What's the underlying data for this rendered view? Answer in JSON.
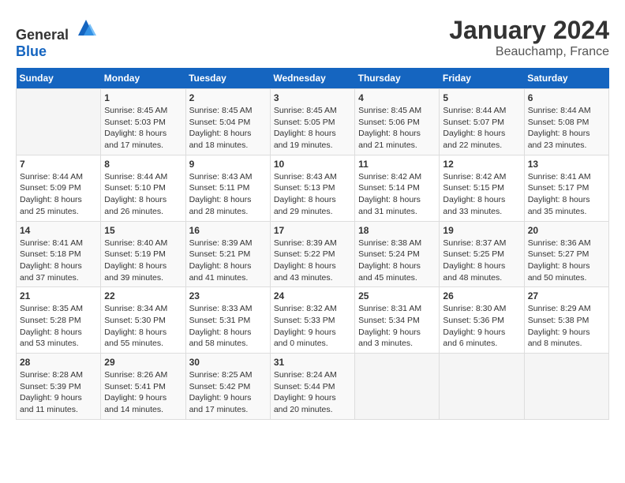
{
  "header": {
    "logo": {
      "text_general": "General",
      "text_blue": "Blue"
    },
    "title": "January 2024",
    "subtitle": "Beauchamp, France"
  },
  "calendar": {
    "days_of_week": [
      "Sunday",
      "Monday",
      "Tuesday",
      "Wednesday",
      "Thursday",
      "Friday",
      "Saturday"
    ],
    "weeks": [
      [
        {
          "day": "",
          "sunrise": "",
          "sunset": "",
          "daylight": ""
        },
        {
          "day": "1",
          "sunrise": "Sunrise: 8:45 AM",
          "sunset": "Sunset: 5:03 PM",
          "daylight": "Daylight: 8 hours and 17 minutes."
        },
        {
          "day": "2",
          "sunrise": "Sunrise: 8:45 AM",
          "sunset": "Sunset: 5:04 PM",
          "daylight": "Daylight: 8 hours and 18 minutes."
        },
        {
          "day": "3",
          "sunrise": "Sunrise: 8:45 AM",
          "sunset": "Sunset: 5:05 PM",
          "daylight": "Daylight: 8 hours and 19 minutes."
        },
        {
          "day": "4",
          "sunrise": "Sunrise: 8:45 AM",
          "sunset": "Sunset: 5:06 PM",
          "daylight": "Daylight: 8 hours and 21 minutes."
        },
        {
          "day": "5",
          "sunrise": "Sunrise: 8:44 AM",
          "sunset": "Sunset: 5:07 PM",
          "daylight": "Daylight: 8 hours and 22 minutes."
        },
        {
          "day": "6",
          "sunrise": "Sunrise: 8:44 AM",
          "sunset": "Sunset: 5:08 PM",
          "daylight": "Daylight: 8 hours and 23 minutes."
        }
      ],
      [
        {
          "day": "7",
          "sunrise": "Sunrise: 8:44 AM",
          "sunset": "Sunset: 5:09 PM",
          "daylight": "Daylight: 8 hours and 25 minutes."
        },
        {
          "day": "8",
          "sunrise": "Sunrise: 8:44 AM",
          "sunset": "Sunset: 5:10 PM",
          "daylight": "Daylight: 8 hours and 26 minutes."
        },
        {
          "day": "9",
          "sunrise": "Sunrise: 8:43 AM",
          "sunset": "Sunset: 5:11 PM",
          "daylight": "Daylight: 8 hours and 28 minutes."
        },
        {
          "day": "10",
          "sunrise": "Sunrise: 8:43 AM",
          "sunset": "Sunset: 5:13 PM",
          "daylight": "Daylight: 8 hours and 29 minutes."
        },
        {
          "day": "11",
          "sunrise": "Sunrise: 8:42 AM",
          "sunset": "Sunset: 5:14 PM",
          "daylight": "Daylight: 8 hours and 31 minutes."
        },
        {
          "day": "12",
          "sunrise": "Sunrise: 8:42 AM",
          "sunset": "Sunset: 5:15 PM",
          "daylight": "Daylight: 8 hours and 33 minutes."
        },
        {
          "day": "13",
          "sunrise": "Sunrise: 8:41 AM",
          "sunset": "Sunset: 5:17 PM",
          "daylight": "Daylight: 8 hours and 35 minutes."
        }
      ],
      [
        {
          "day": "14",
          "sunrise": "Sunrise: 8:41 AM",
          "sunset": "Sunset: 5:18 PM",
          "daylight": "Daylight: 8 hours and 37 minutes."
        },
        {
          "day": "15",
          "sunrise": "Sunrise: 8:40 AM",
          "sunset": "Sunset: 5:19 PM",
          "daylight": "Daylight: 8 hours and 39 minutes."
        },
        {
          "day": "16",
          "sunrise": "Sunrise: 8:39 AM",
          "sunset": "Sunset: 5:21 PM",
          "daylight": "Daylight: 8 hours and 41 minutes."
        },
        {
          "day": "17",
          "sunrise": "Sunrise: 8:39 AM",
          "sunset": "Sunset: 5:22 PM",
          "daylight": "Daylight: 8 hours and 43 minutes."
        },
        {
          "day": "18",
          "sunrise": "Sunrise: 8:38 AM",
          "sunset": "Sunset: 5:24 PM",
          "daylight": "Daylight: 8 hours and 45 minutes."
        },
        {
          "day": "19",
          "sunrise": "Sunrise: 8:37 AM",
          "sunset": "Sunset: 5:25 PM",
          "daylight": "Daylight: 8 hours and 48 minutes."
        },
        {
          "day": "20",
          "sunrise": "Sunrise: 8:36 AM",
          "sunset": "Sunset: 5:27 PM",
          "daylight": "Daylight: 8 hours and 50 minutes."
        }
      ],
      [
        {
          "day": "21",
          "sunrise": "Sunrise: 8:35 AM",
          "sunset": "Sunset: 5:28 PM",
          "daylight": "Daylight: 8 hours and 53 minutes."
        },
        {
          "day": "22",
          "sunrise": "Sunrise: 8:34 AM",
          "sunset": "Sunset: 5:30 PM",
          "daylight": "Daylight: 8 hours and 55 minutes."
        },
        {
          "day": "23",
          "sunrise": "Sunrise: 8:33 AM",
          "sunset": "Sunset: 5:31 PM",
          "daylight": "Daylight: 8 hours and 58 minutes."
        },
        {
          "day": "24",
          "sunrise": "Sunrise: 8:32 AM",
          "sunset": "Sunset: 5:33 PM",
          "daylight": "Daylight: 9 hours and 0 minutes."
        },
        {
          "day": "25",
          "sunrise": "Sunrise: 8:31 AM",
          "sunset": "Sunset: 5:34 PM",
          "daylight": "Daylight: 9 hours and 3 minutes."
        },
        {
          "day": "26",
          "sunrise": "Sunrise: 8:30 AM",
          "sunset": "Sunset: 5:36 PM",
          "daylight": "Daylight: 9 hours and 6 minutes."
        },
        {
          "day": "27",
          "sunrise": "Sunrise: 8:29 AM",
          "sunset": "Sunset: 5:38 PM",
          "daylight": "Daylight: 9 hours and 8 minutes."
        }
      ],
      [
        {
          "day": "28",
          "sunrise": "Sunrise: 8:28 AM",
          "sunset": "Sunset: 5:39 PM",
          "daylight": "Daylight: 9 hours and 11 minutes."
        },
        {
          "day": "29",
          "sunrise": "Sunrise: 8:26 AM",
          "sunset": "Sunset: 5:41 PM",
          "daylight": "Daylight: 9 hours and 14 minutes."
        },
        {
          "day": "30",
          "sunrise": "Sunrise: 8:25 AM",
          "sunset": "Sunset: 5:42 PM",
          "daylight": "Daylight: 9 hours and 17 minutes."
        },
        {
          "day": "31",
          "sunrise": "Sunrise: 8:24 AM",
          "sunset": "Sunset: 5:44 PM",
          "daylight": "Daylight: 9 hours and 20 minutes."
        },
        {
          "day": "",
          "sunrise": "",
          "sunset": "",
          "daylight": ""
        },
        {
          "day": "",
          "sunrise": "",
          "sunset": "",
          "daylight": ""
        },
        {
          "day": "",
          "sunrise": "",
          "sunset": "",
          "daylight": ""
        }
      ]
    ]
  }
}
